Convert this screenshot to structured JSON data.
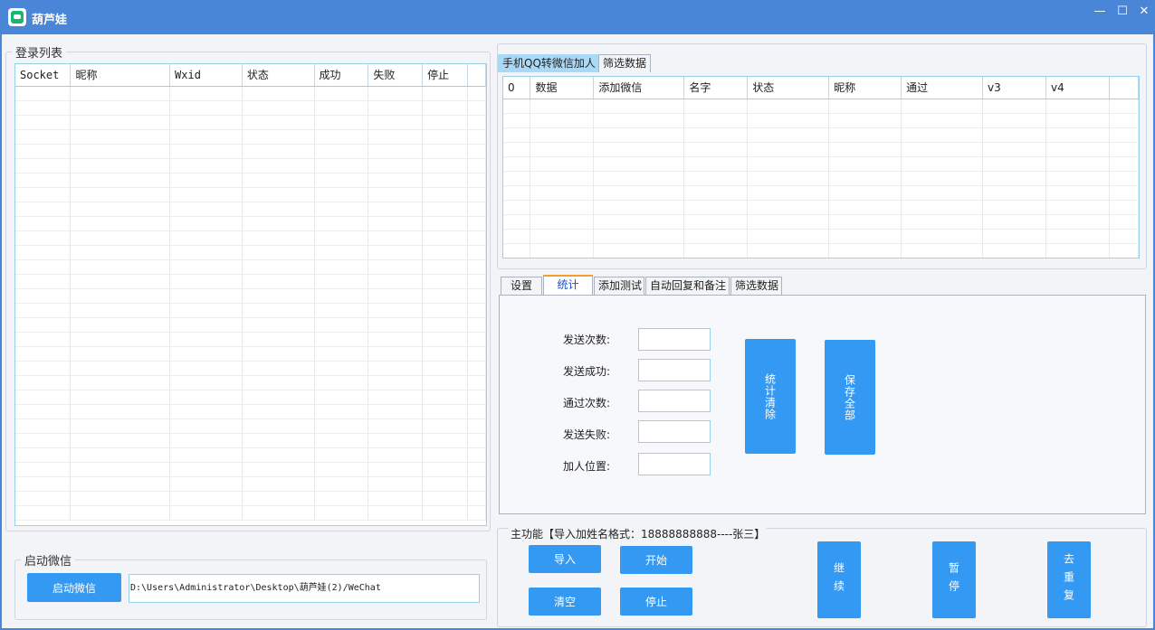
{
  "window": {
    "title": "葫芦娃",
    "minimize": "—",
    "maximize": "☐",
    "close": "✕"
  },
  "login_list": {
    "legend": "登录列表",
    "columns": [
      "Socket",
      "昵称",
      "Wxid",
      "状态",
      "成功",
      "失败",
      "停止"
    ]
  },
  "top_tabs": [
    "手机QQ转微信加人",
    "筛选数据"
  ],
  "top_grid": {
    "columns": [
      "0",
      "数据",
      "添加微信",
      "名字",
      "状态",
      "昵称",
      "通过",
      "v3",
      "v4"
    ]
  },
  "mid_tabs": [
    "设置",
    "统计",
    "添加测试",
    "自动回复和备注",
    "筛选数据"
  ],
  "stats": {
    "labels": [
      "发送次数:",
      "发送成功:",
      "通过次数:",
      "发送失败:",
      "加人位置:"
    ],
    "values": [
      "",
      "",
      "",
      "",
      ""
    ],
    "clear_button": "统计清除",
    "save_button": "保存全部"
  },
  "launch": {
    "legend": "启动微信",
    "button": "启动微信",
    "path": "D:\\Users\\Administrator\\Desktop\\葫芦娃(2)/WeChat"
  },
  "main_function": {
    "legend": "主功能【导入加姓名格式：18888888888----张三】",
    "import": "导入",
    "start": "开始",
    "clear": "清空",
    "stop": "停止",
    "continue": "继续",
    "pause": "暂停",
    "dedupe": "去重复"
  },
  "colors": {
    "titlebar": "#4a86d8",
    "button": "#3399f3",
    "grid_border": "#9ad0e6",
    "active_tab_blue": "#a9d9f6",
    "active_tab_accent": "#f0a030"
  }
}
